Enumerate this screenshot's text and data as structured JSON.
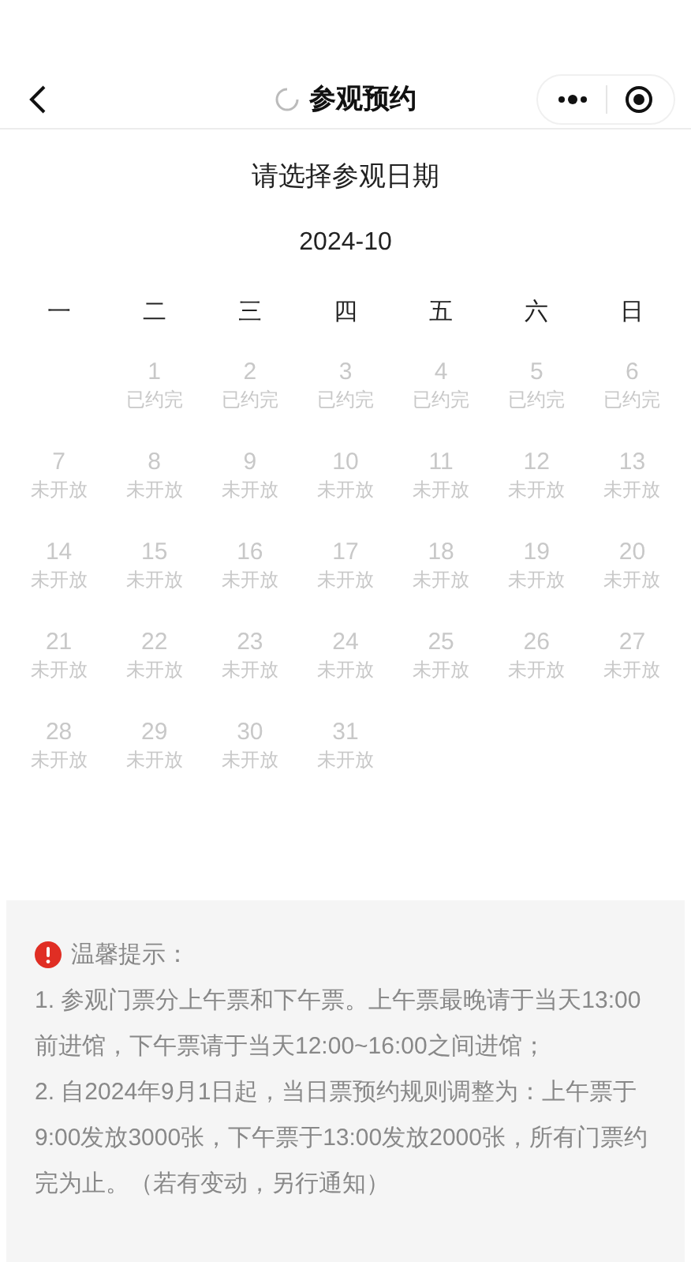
{
  "nav": {
    "title": "参观预约"
  },
  "calendar": {
    "heading": "请选择参观日期",
    "month": "2024-10",
    "weekdays": [
      "一",
      "二",
      "三",
      "四",
      "五",
      "六",
      "日"
    ],
    "cells": [
      {
        "kind": "empty"
      },
      {
        "kind": "day",
        "day": "1",
        "status": "已约完",
        "disabled": true
      },
      {
        "kind": "day",
        "day": "2",
        "status": "已约完",
        "disabled": true
      },
      {
        "kind": "day",
        "day": "3",
        "status": "已约完",
        "disabled": true
      },
      {
        "kind": "day",
        "day": "4",
        "status": "已约完",
        "disabled": true
      },
      {
        "kind": "day",
        "day": "5",
        "status": "已约完",
        "disabled": true
      },
      {
        "kind": "day",
        "day": "6",
        "status": "已约完",
        "disabled": true
      },
      {
        "kind": "day",
        "day": "7",
        "status": "未开放",
        "disabled": true
      },
      {
        "kind": "day",
        "day": "8",
        "status": "未开放",
        "disabled": true
      },
      {
        "kind": "day",
        "day": "9",
        "status": "未开放",
        "disabled": true
      },
      {
        "kind": "day",
        "day": "10",
        "status": "未开放",
        "disabled": true
      },
      {
        "kind": "day",
        "day": "11",
        "status": "未开放",
        "disabled": true
      },
      {
        "kind": "day",
        "day": "12",
        "status": "未开放",
        "disabled": true
      },
      {
        "kind": "day",
        "day": "13",
        "status": "未开放",
        "disabled": true
      },
      {
        "kind": "day",
        "day": "14",
        "status": "未开放",
        "disabled": true
      },
      {
        "kind": "day",
        "day": "15",
        "status": "未开放",
        "disabled": true
      },
      {
        "kind": "day",
        "day": "16",
        "status": "未开放",
        "disabled": true
      },
      {
        "kind": "day",
        "day": "17",
        "status": "未开放",
        "disabled": true
      },
      {
        "kind": "day",
        "day": "18",
        "status": "未开放",
        "disabled": true
      },
      {
        "kind": "day",
        "day": "19",
        "status": "未开放",
        "disabled": true
      },
      {
        "kind": "day",
        "day": "20",
        "status": "未开放",
        "disabled": true
      },
      {
        "kind": "day",
        "day": "21",
        "status": "未开放",
        "disabled": true
      },
      {
        "kind": "day",
        "day": "22",
        "status": "未开放",
        "disabled": true
      },
      {
        "kind": "day",
        "day": "23",
        "status": "未开放",
        "disabled": true
      },
      {
        "kind": "day",
        "day": "24",
        "status": "未开放",
        "disabled": true
      },
      {
        "kind": "day",
        "day": "25",
        "status": "未开放",
        "disabled": true
      },
      {
        "kind": "day",
        "day": "26",
        "status": "未开放",
        "disabled": true
      },
      {
        "kind": "day",
        "day": "27",
        "status": "未开放",
        "disabled": true
      },
      {
        "kind": "day",
        "day": "28",
        "status": "未开放",
        "disabled": true
      },
      {
        "kind": "day",
        "day": "29",
        "status": "未开放",
        "disabled": true
      },
      {
        "kind": "day",
        "day": "30",
        "status": "未开放",
        "disabled": true
      },
      {
        "kind": "day",
        "day": "31",
        "status": "未开放",
        "disabled": true
      }
    ]
  },
  "notice": {
    "title": "温馨提示：",
    "items": [
      "1. 参观门票分上午票和下午票。上午票最晚请于当天13:00前进馆，下午票请于当天12:00~16:00之间进馆；",
      "2. 自2024年9月1日起，当日票预约规则调整为：上午票于9:00发放3000张，下午票于13:00发放2000张，所有门票约完为止。（若有变动，另行通知）"
    ]
  }
}
